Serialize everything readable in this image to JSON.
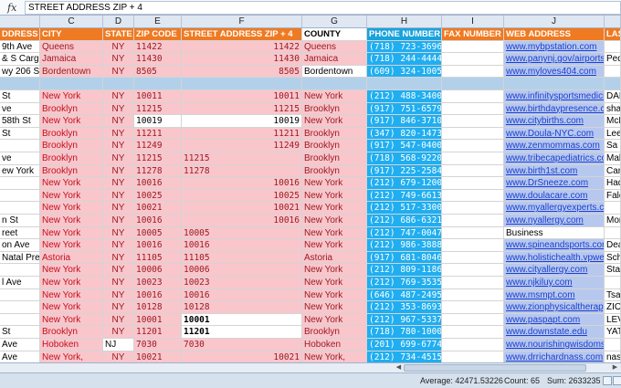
{
  "formula_bar": {
    "fx_symbol": "fx",
    "value": "STREET ADDRESS ZIP + 4"
  },
  "columns": [
    "C",
    "D",
    "E",
    "F",
    "G",
    "H",
    "I",
    "J"
  ],
  "headers": {
    "address": "DDRESS",
    "city": "CITY",
    "state": "STATE",
    "zip": "ZIP CODE",
    "zip4": "STREET ADDRESS ZIP + 4",
    "county": "COUNTY",
    "phone": "PHONE NUMBER",
    "fax": "FAX NUMBER",
    "web": "WEB ADDRESS",
    "last": "LAS"
  },
  "rows": [
    {
      "address": "9th Ave",
      "city": "Queens",
      "state": "NY",
      "zip": "11422",
      "zip4": "11422",
      "county": "Queens",
      "phone": "(718) 723-3696",
      "web": "www.mybpstation.com",
      "last": ""
    },
    {
      "address": "& S Cargo",
      "city": "Jamaica",
      "state": "NY",
      "zip": "11430",
      "zip4": "11430",
      "county": "Jamaica",
      "phone": "(718) 244-4444",
      "web": "www.panynj.gov/airports/j",
      "last": "Ped"
    },
    {
      "address": "wy 206 S",
      "city": "Bordentown",
      "state": "NY",
      "zip": "8505",
      "zip4": "8505",
      "county": "Bordentown",
      "phone": "(609) 324-1005",
      "web": "www.myloves404.com",
      "last": ""
    },
    {
      "address": "",
      "city": "",
      "state": "",
      "zip": "",
      "zip4": "",
      "county": "",
      "phone": "",
      "web": "",
      "last": ""
    },
    {
      "address": "St",
      "city": "New York",
      "state": "NY",
      "zip": "10011",
      "zip4": "10011",
      "county": "New York",
      "phone": "(212) 488-3400",
      "web": "www.infinitysportsmedicin",
      "last": "DAN"
    },
    {
      "address": "ve",
      "city": "Brooklyn",
      "state": "NY",
      "zip": "11215",
      "zip4": "11215",
      "county": "Brooklyn",
      "phone": "(917) 751-6579",
      "web": "www.birthdaypresence.co",
      "last": "sha"
    },
    {
      "address": "58th St",
      "city": "New York",
      "state": "NY",
      "zip": "10019",
      "zip4": "10019",
      "county": "New York",
      "phone": "(917) 846-3710",
      "web": "www.citybirths.com",
      "last": "McK"
    },
    {
      "address": "St",
      "city": "Brooklyn",
      "state": "NY",
      "zip": "11211",
      "zip4": "11211",
      "county": "Brooklyn",
      "phone": "(347) 820-1473",
      "web": "www.Doula-NYC.com",
      "last": "Lee"
    },
    {
      "address": "",
      "city": "Brooklyn",
      "state": "NY",
      "zip": "11249",
      "zip4": "11249",
      "county": "Brooklyn",
      "phone": "(917) 547-0400",
      "web": "www.zenmommas.com",
      "last": "Sa"
    },
    {
      "address": "ve",
      "city": "Brooklyn",
      "state": "NY",
      "zip": "11215",
      "zip4": "11215",
      "county": "Brooklyn",
      "phone": "(718) 568-9220",
      "web": "www.tribecapediatrics.co",
      "last": "Mal"
    },
    {
      "address": "ew York",
      "city": "Brooklyn",
      "state": "NY",
      "zip": "11278",
      "zip4": "11278",
      "county": "Brooklyn",
      "phone": "(917) 225-2584",
      "web": "www.birth1st.com",
      "last": "Car"
    },
    {
      "address": "",
      "city": "New York",
      "state": "NY",
      "zip": "10016",
      "zip4": "10016",
      "county": "New York",
      "phone": "(212) 679-1200",
      "web": "www.DrSneeze.com",
      "last": "Had"
    },
    {
      "address": "",
      "city": "New York",
      "state": "NY",
      "zip": "10025",
      "zip4": "10025",
      "county": "New York",
      "phone": "(212) 749-6613",
      "web": "www.doulacare.com",
      "last": "Falc"
    },
    {
      "address": "",
      "city": "New York",
      "state": "NY",
      "zip": "10021",
      "zip4": "10021",
      "county": "New York",
      "phone": "(212) 517-3300",
      "web": "www.myallergyexperts.com",
      "last": ""
    },
    {
      "address": "n St",
      "city": "New York",
      "state": "NY",
      "zip": "10016",
      "zip4": "10016",
      "county": "New York",
      "phone": "(212) 686-6321",
      "web": "www.nyallergy.com",
      "last": "Mor"
    },
    {
      "address": "reet",
      "city": "New York",
      "state": "NY",
      "zip": "10005",
      "zip4": "10005",
      "county": "New York",
      "phone": "(212) 747-0047",
      "web": "Business",
      "last": ""
    },
    {
      "address": "on Ave",
      "city": "New York",
      "state": "NY",
      "zip": "10016",
      "zip4": "10016",
      "county": "New York",
      "phone": "(212) 986-3888",
      "web": "www.spineandsports.com",
      "last": "Dea"
    },
    {
      "address": "Natal Prep",
      "city": "Astoria",
      "state": "NY",
      "zip": "11105",
      "zip4": "11105",
      "county": "Astoria",
      "phone": "(917) 681-8046",
      "web": "www.holistichealth.vpweb",
      "last": "Sch"
    },
    {
      "address": "",
      "city": "New York",
      "state": "NY",
      "zip": "10006",
      "zip4": "10006",
      "county": "New York",
      "phone": "(212) 809-1186",
      "web": "www.cityallergy.com",
      "last": "Sta"
    },
    {
      "address": "l Ave",
      "city": "New York",
      "state": "NY",
      "zip": "10023",
      "zip4": "10023",
      "county": "New York",
      "phone": "(212) 769-3535",
      "web": "www.njkiluy.com",
      "last": ""
    },
    {
      "address": "",
      "city": "New York",
      "state": "NY",
      "zip": "10016",
      "zip4": "10016",
      "county": "New York",
      "phone": "(646) 487-2495",
      "web": "www.msmpt.com",
      "last": "Tsa"
    },
    {
      "address": "",
      "city": "New York",
      "state": "NY",
      "zip": "10128",
      "zip4": "10128",
      "county": "New York",
      "phone": "(212) 353-8693",
      "web": "www.zionphysicaltherapy",
      "last": "ZIO"
    },
    {
      "address": "",
      "city": "New York",
      "state": "NY",
      "zip": "10001",
      "zip4": "10001",
      "county": "New York",
      "phone": "(212) 967-5337",
      "web": "www.paspapt.com",
      "last": "LEV"
    },
    {
      "address": "St",
      "city": "Brooklyn",
      "state": "NY",
      "zip": "11201",
      "zip4": "11201",
      "county": "Brooklyn",
      "phone": "(718) 780-1000",
      "web": "www.downstate.edu",
      "last": "YAT"
    },
    {
      "address": "Ave",
      "city": "Hoboken",
      "state": "NJ",
      "zip": "7030",
      "zip4": "7030",
      "county": "Hoboken",
      "phone": "(201) 699-6774",
      "web": "www.nourishingwisdomservice",
      "last": ""
    },
    {
      "address": "Ave",
      "city": "New York,",
      "state": "NY",
      "zip": "10021",
      "zip4": "10021",
      "county": "New York,",
      "phone": "(212) 734-4515",
      "web": "www.drrichardnass.com",
      "last": "nas"
    }
  ],
  "status_bar": {
    "average": "Average: 42471.53226",
    "count": "Count: 65",
    "sum": "Sum: 2633235"
  }
}
